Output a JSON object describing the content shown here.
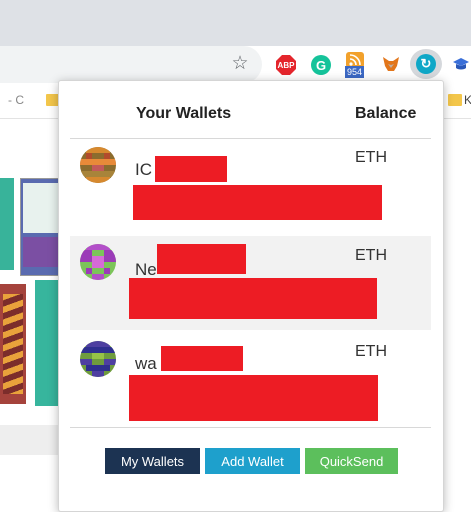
{
  "browser": {
    "bookmarks_fragment_left": "- C",
    "bookmarks_fragment_right": "K",
    "rss_badge": "954",
    "extension_icons": [
      "star-icon",
      "adblock-plus-icon",
      "grammarly-icon",
      "rss-feed-icon",
      "metamask-fox-icon",
      "wallet-extension-icon",
      "graduation-cap-icon"
    ]
  },
  "popup": {
    "header_wallets": "Your Wallets",
    "header_balance": "Balance",
    "wallets": [
      {
        "name_visible": "IC",
        "currency": "ETH"
      },
      {
        "name_visible": "Ne",
        "currency": "ETH"
      },
      {
        "name_visible": "wa",
        "currency": "ETH"
      }
    ],
    "buttons": {
      "my_wallets": "My Wallets",
      "add_wallet": "Add Wallet",
      "quicksend": "QuickSend"
    }
  },
  "colors": {
    "my_wallets_bg": "#1c3352",
    "add_wallet_bg": "#1ea0cc",
    "quicksend_bg": "#5cbf5c",
    "redaction": "#ed1c24"
  }
}
